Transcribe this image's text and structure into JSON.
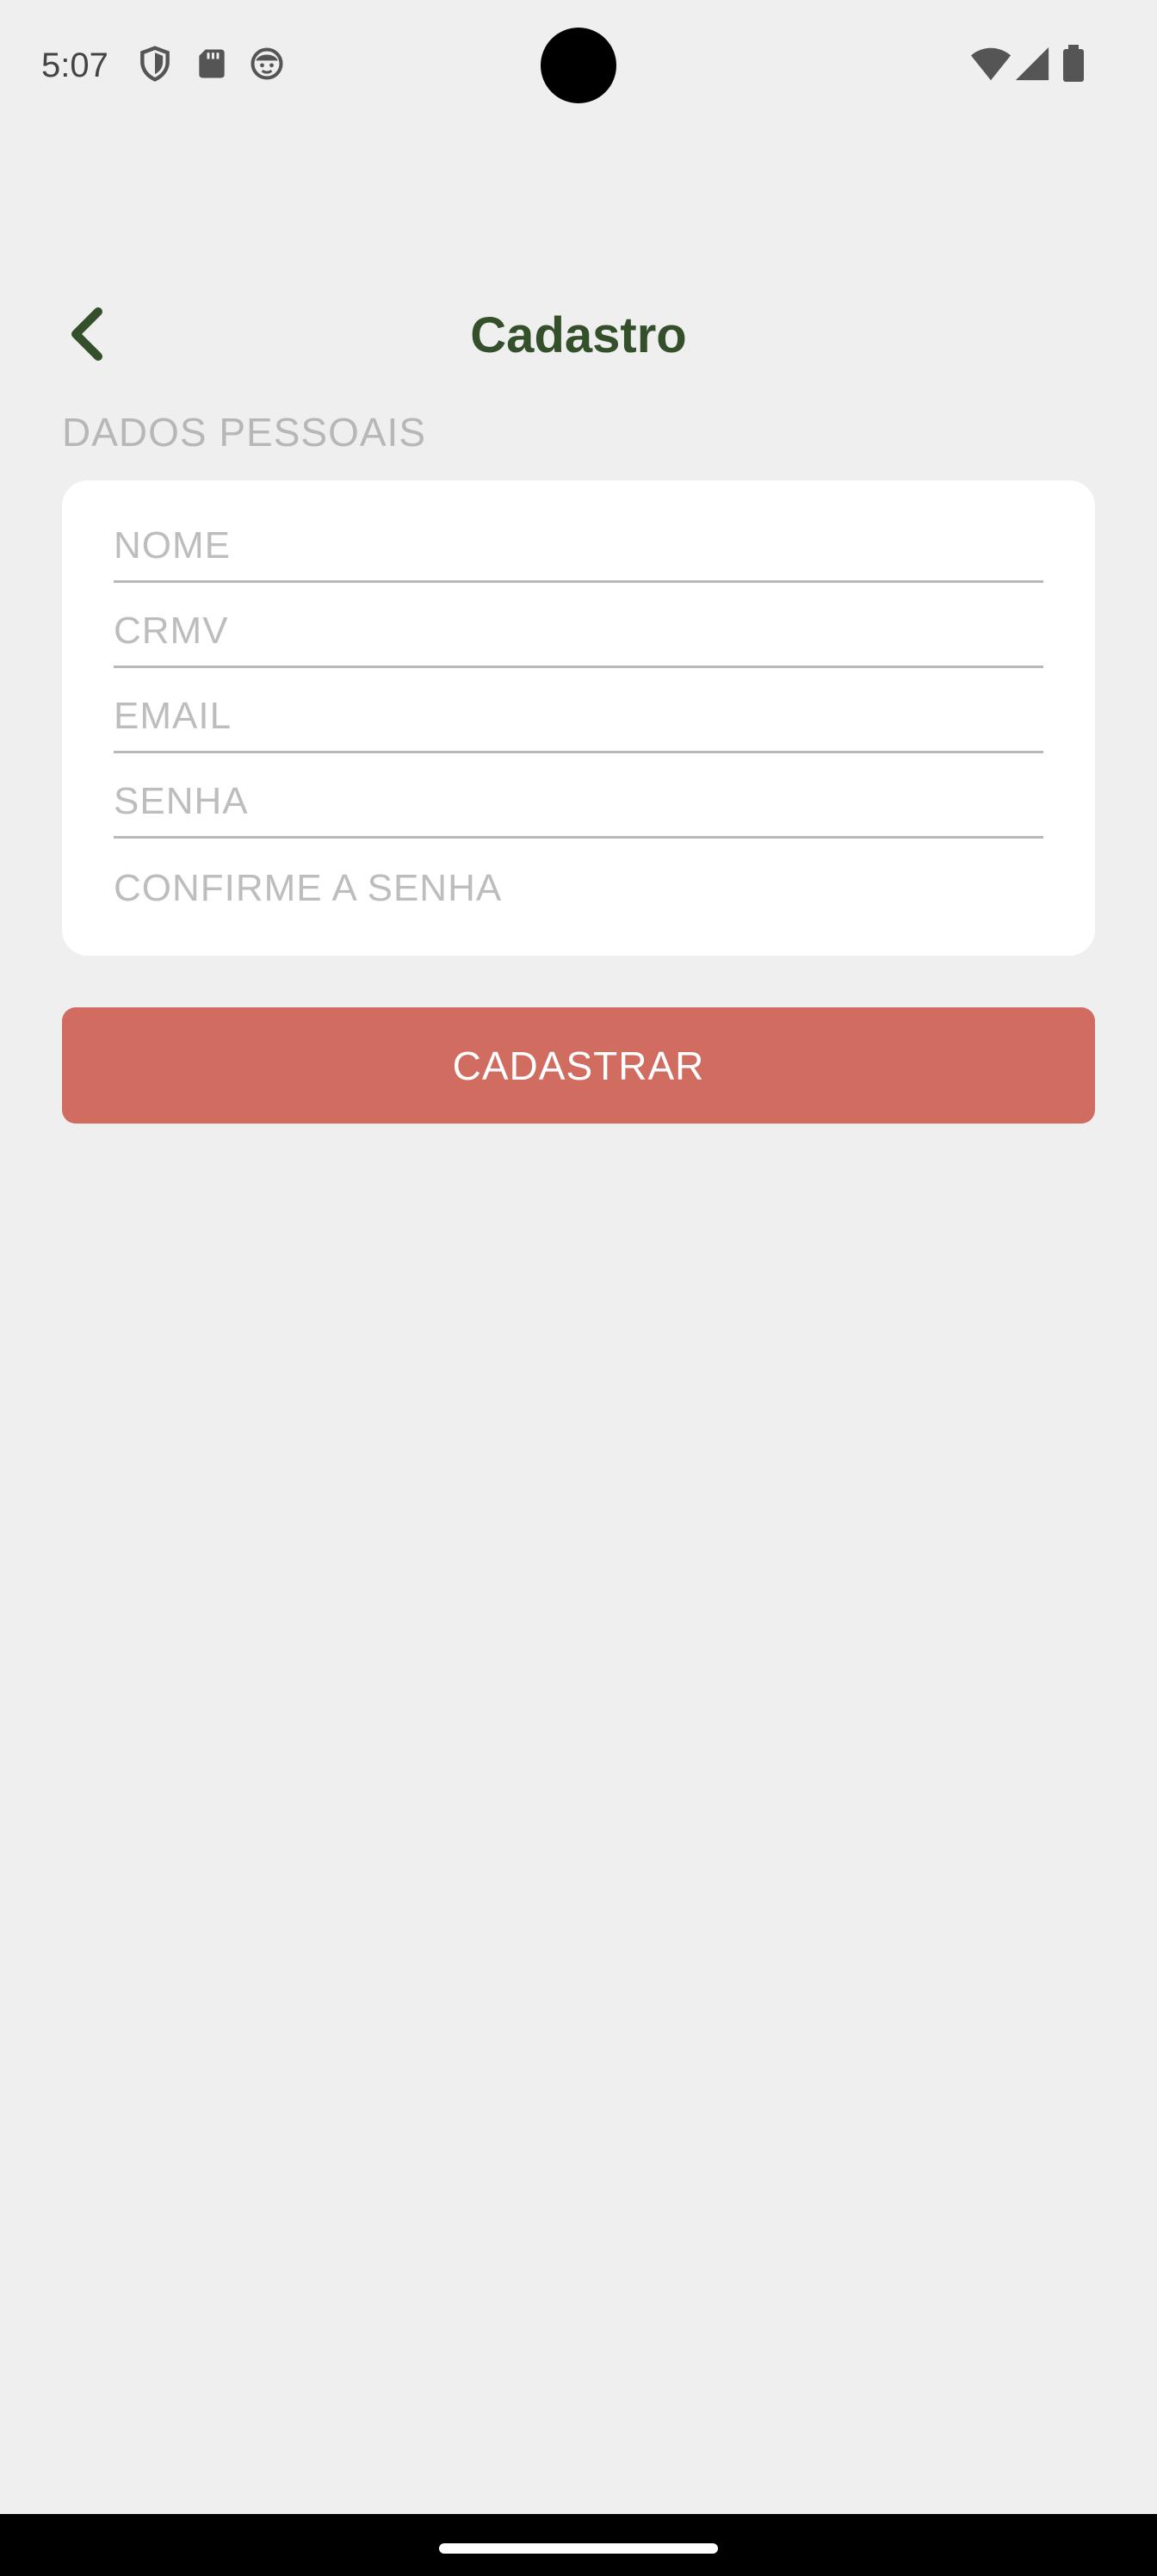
{
  "status_bar": {
    "time": "5:07",
    "left_icons": [
      "shield-icon",
      "sd-card-icon",
      "face-icon"
    ],
    "right_icons": [
      "wifi-icon",
      "signal-icon",
      "battery-icon"
    ]
  },
  "header": {
    "title": "Cadastro",
    "back_icon": "chevron-left-icon"
  },
  "section": {
    "label": "DADOS PESSOAIS"
  },
  "form": {
    "fields": [
      {
        "placeholder": "NOME",
        "value": ""
      },
      {
        "placeholder": "CRMV",
        "value": ""
      },
      {
        "placeholder": "EMAIL",
        "value": ""
      },
      {
        "placeholder": "SENHA",
        "value": ""
      },
      {
        "placeholder": "CONFIRME A SENHA",
        "value": ""
      }
    ]
  },
  "actions": {
    "submit_label": "CADASTRAR"
  },
  "colors": {
    "background": "#efefef",
    "title": "#33502a",
    "accent_button": "#d06c60",
    "placeholder": "#bdbdbd",
    "divider": "#b9b9b9"
  }
}
